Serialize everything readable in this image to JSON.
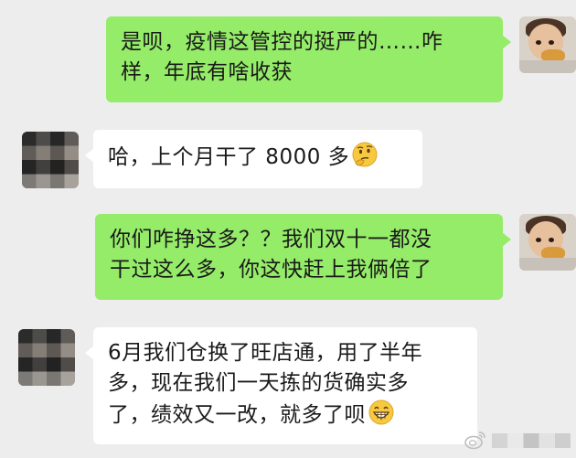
{
  "chat": {
    "messages": [
      {
        "sender": "me",
        "lines": [
          "是呗，疫情这管控的挺严的……咋",
          "样，年底有啥收获"
        ]
      },
      {
        "sender": "them",
        "lines": [
          "哈，上个月干了 8000 多"
        ],
        "emoji": "thinking-face-emoji"
      },
      {
        "sender": "me",
        "lines": [
          "你们咋挣这多？？我们双十一都没",
          "干过这么多，你这快赶上我俩倍了"
        ]
      },
      {
        "sender": "them",
        "lines": [
          "6月我们仓换了旺店通，用了半年",
          "多，现在我们一天拣的货确实多",
          "了，绩效又一改，就多了呗"
        ],
        "emoji": "grinning-face-emoji"
      }
    ]
  },
  "colors": {
    "background": "#ededed",
    "my_bubble": "#95ec69",
    "their_bubble": "#ffffff"
  }
}
